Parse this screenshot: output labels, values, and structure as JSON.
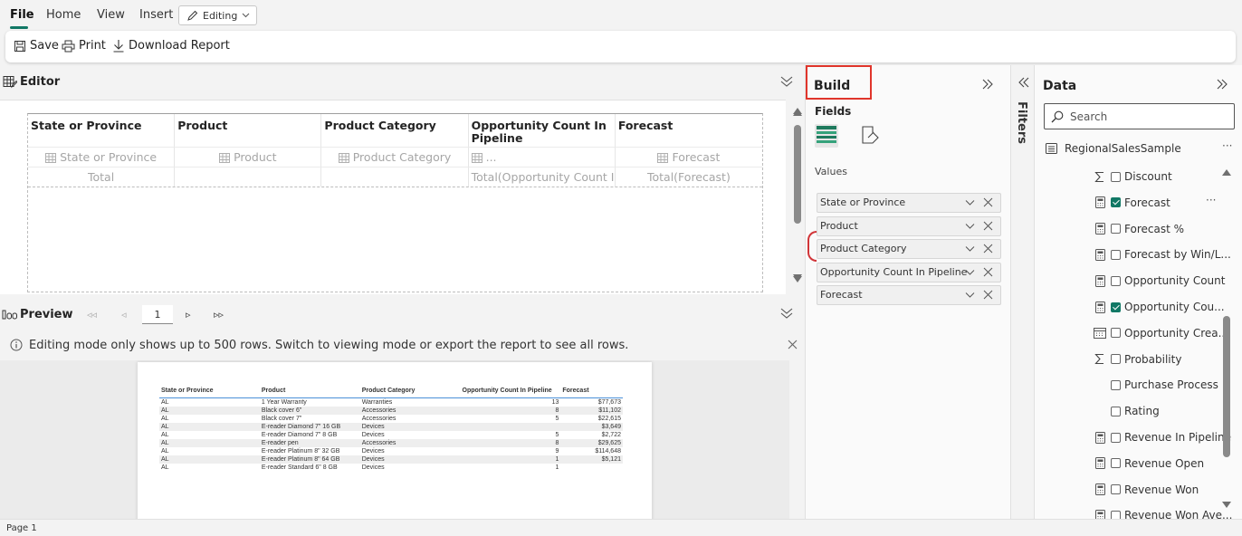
{
  "menu": {
    "file": "File",
    "home": "Home",
    "view": "View",
    "insert": "Insert",
    "editing": "Editing"
  },
  "toolbar": {
    "save": "Save",
    "print": "Print",
    "download": "Download Report"
  },
  "editor": {
    "title": "Editor",
    "columns": [
      "State or Province",
      "Product",
      "Product Category",
      "Opportunity Count In Pipeline",
      "Forecast"
    ],
    "placeholders": [
      "State or Province",
      "Product",
      "Product Category",
      "...",
      "Forecast"
    ],
    "totals": [
      "Total",
      "",
      "",
      "Total(Opportunity Count In...",
      "Total(Forecast)"
    ]
  },
  "preview": {
    "title": "Preview",
    "page": "1",
    "info": "Editing mode only shows up to 500 rows. Switch to viewing mode or export the report to see all rows.",
    "report": {
      "headers": [
        "State or Province",
        "Product",
        "Product Category",
        "Opportunity Count In Pipeline",
        "Forecast"
      ],
      "rows": [
        [
          "AL",
          "1 Year Warranty",
          "Warranties",
          "13",
          "$77,673"
        ],
        [
          "AL",
          "Black cover 6\"",
          "Accessories",
          "8",
          "$11,102"
        ],
        [
          "AL",
          "Black cover 7\"",
          "Accessories",
          "5",
          "$22,615"
        ],
        [
          "AL",
          "E-reader Diamond 7\" 16 GB",
          "Devices",
          "",
          "$3,649"
        ],
        [
          "AL",
          "E-reader Diamond 7\" 8 GB",
          "Devices",
          "5",
          "$2,722"
        ],
        [
          "AL",
          "E-reader pen",
          "Accessories",
          "8",
          "$29,625"
        ],
        [
          "AL",
          "E-reader Platinum 8\" 32 GB",
          "Devices",
          "9",
          "$114,648"
        ],
        [
          "AL",
          "E-reader Platinum 8\" 64 GB",
          "Devices",
          "1",
          "$5,121"
        ],
        [
          "AL",
          "E-reader Standard 6\" 8 GB",
          "Devices",
          "1",
          ""
        ]
      ]
    }
  },
  "status": {
    "page": "Page 1"
  },
  "build": {
    "title": "Build",
    "fields_label": "Fields",
    "values_label": "Values",
    "wells": [
      "State or Province",
      "Product",
      "Product Category",
      "Opportunity Count In Pipeline",
      "Forecast"
    ]
  },
  "filters": {
    "label": "Filters"
  },
  "data_pane": {
    "title": "Data",
    "search_placeholder": "Search",
    "table": "RegionalSalesSample",
    "fields": [
      {
        "icon": "sigma",
        "label": "Discount",
        "checked": false
      },
      {
        "icon": "calculator",
        "label": "Forecast",
        "checked": true
      },
      {
        "icon": "calculator",
        "label": "Forecast %",
        "checked": false
      },
      {
        "icon": "calculator",
        "label": "Forecast by Win/L...",
        "checked": false
      },
      {
        "icon": "calculator",
        "label": "Opportunity Count",
        "checked": false
      },
      {
        "icon": "calculator",
        "label": "Opportunity Cou...",
        "checked": true
      },
      {
        "icon": "calendar",
        "label": "Opportunity Crea...",
        "checked": false
      },
      {
        "icon": "sigma",
        "label": "Probability",
        "checked": false
      },
      {
        "icon": "none",
        "label": "Purchase Process",
        "checked": false
      },
      {
        "icon": "none",
        "label": "Rating",
        "checked": false
      },
      {
        "icon": "calculator",
        "label": "Revenue In Pipeline",
        "checked": false
      },
      {
        "icon": "calculator",
        "label": "Revenue Open",
        "checked": false
      },
      {
        "icon": "calculator",
        "label": "Revenue Won",
        "checked": false
      },
      {
        "icon": "calculator",
        "label": "Revenue Won Ave...",
        "checked": false
      }
    ]
  },
  "colors": {
    "accent": "#117865",
    "highlight": "#e0352b",
    "report_header_rule": "#4a90d9"
  }
}
